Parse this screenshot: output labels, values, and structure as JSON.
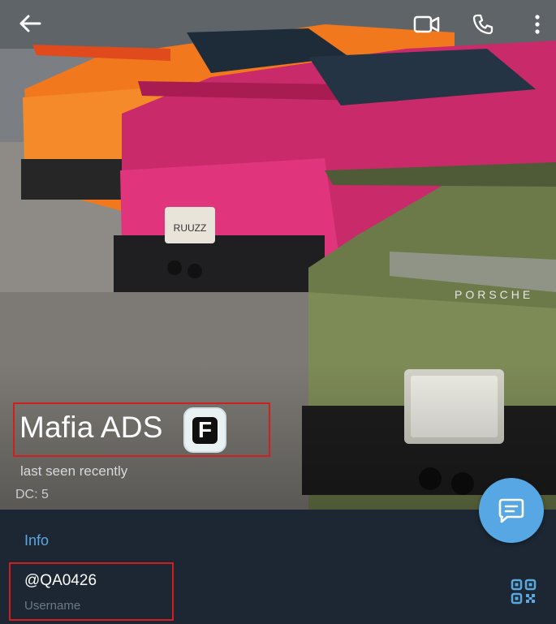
{
  "topbar": {
    "back_icon": "arrow-left-icon",
    "video_icon": "video-camera-icon",
    "call_icon": "phone-icon",
    "more_icon": "more-vertical-icon"
  },
  "profile": {
    "name": "Mafia ADS",
    "badge_letter": "F",
    "status": "last seen recently",
    "dc": "DC: 5"
  },
  "fab": {
    "icon": "message-icon"
  },
  "info": {
    "title": "Info",
    "username": "@QA0426",
    "username_caption": "Username",
    "qr_icon": "qr-code-icon"
  },
  "colors": {
    "panel_bg": "#1c2733",
    "accent": "#5aa8e0",
    "fab_bg": "#56a7e4",
    "highlight_border": "#d11f1f"
  }
}
